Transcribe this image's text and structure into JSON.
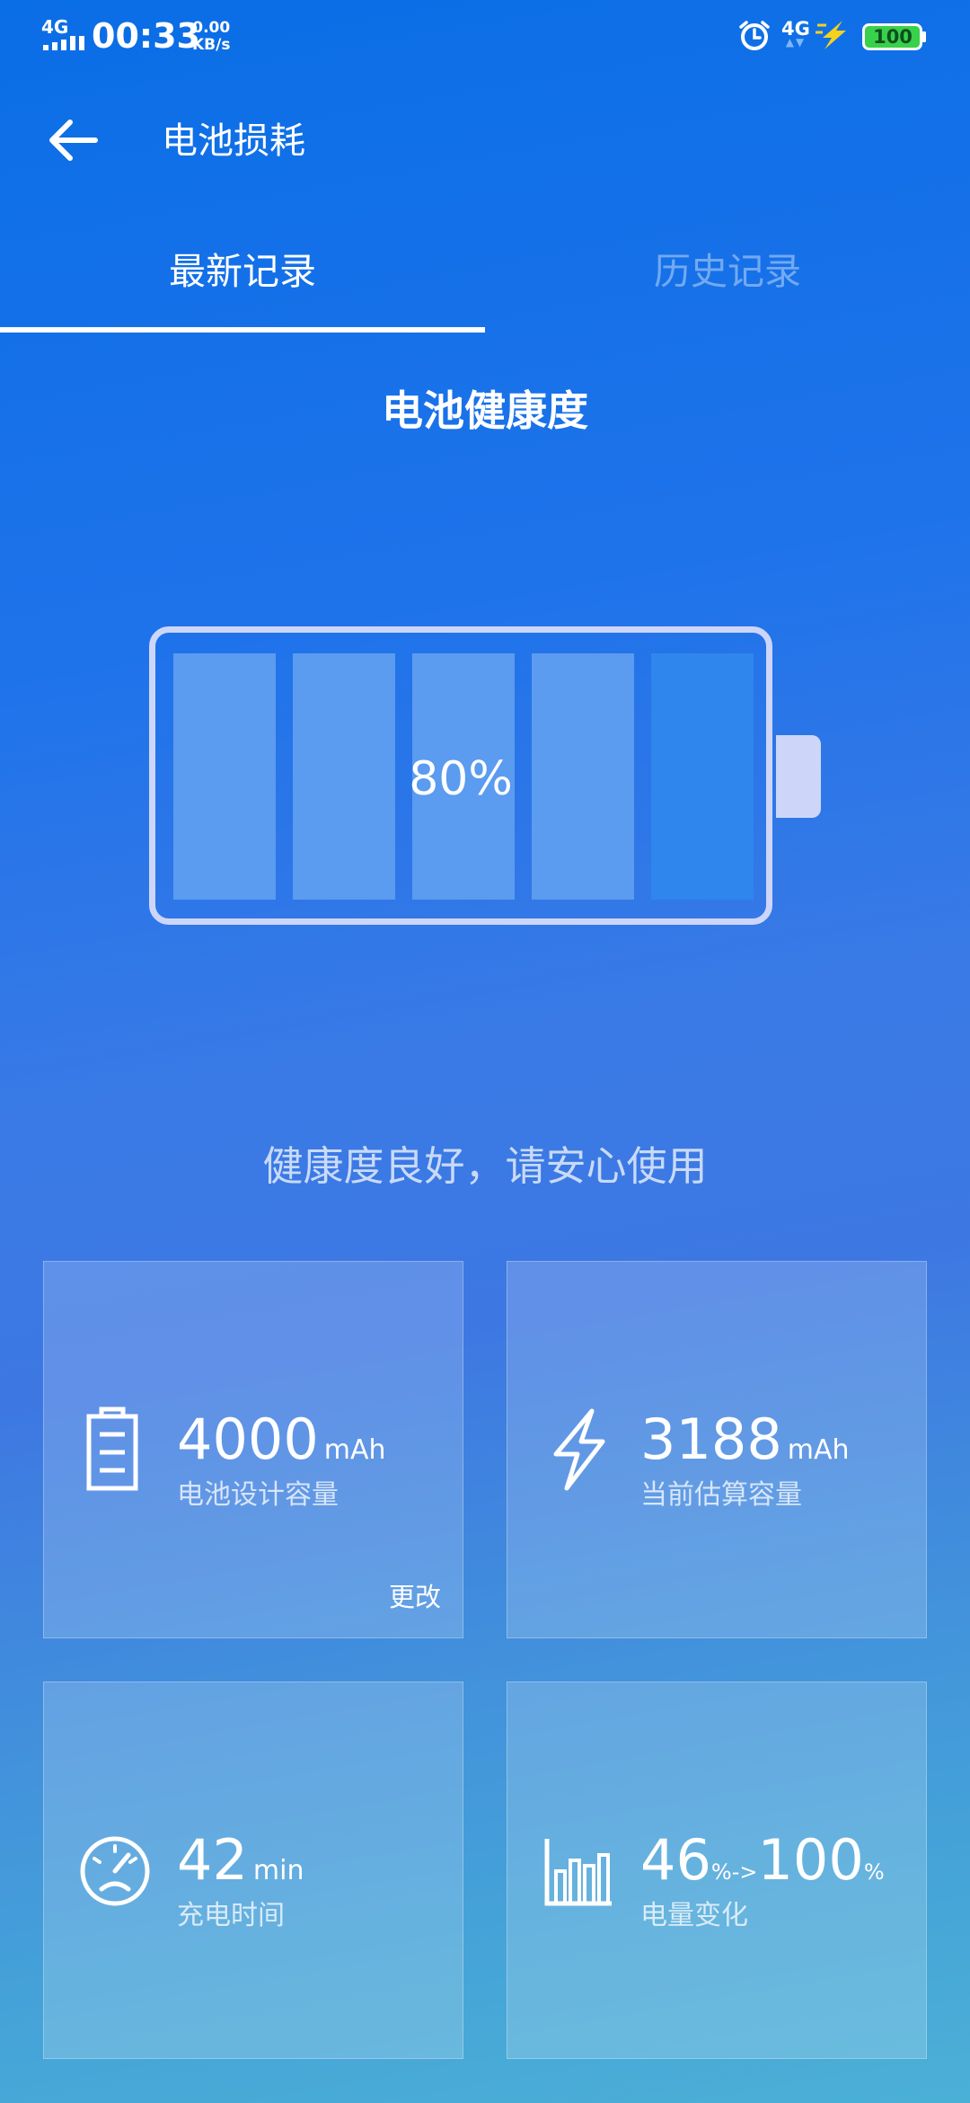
{
  "status_bar": {
    "network_left": "4G",
    "time": "00:33",
    "speed_value": "0.00",
    "speed_unit": "KB/s",
    "network_right": "4G",
    "battery_level": "100",
    "battery_color": "#39d14b"
  },
  "header": {
    "title": "电池损耗"
  },
  "tabs": [
    {
      "label": "最新记录",
      "active": true
    },
    {
      "label": "历史记录",
      "active": false
    }
  ],
  "battery_health": {
    "section_title": "电池健康度",
    "percent_text": "80%",
    "percent": 80,
    "status_message": "健康度良好，请安心使用"
  },
  "cards": [
    {
      "icon": "battery-icon",
      "value": "4000",
      "unit": "mAh",
      "label": "电池设计容量",
      "action": "更改"
    },
    {
      "icon": "lightning-icon",
      "value": "3188",
      "unit": "mAh",
      "label": "当前估算容量"
    },
    {
      "icon": "speedometer-icon",
      "value": "42",
      "unit": "min",
      "label": "充电时间"
    },
    {
      "icon": "bar-chart-icon",
      "value_from": "46",
      "unit_from": "%->",
      "value_to": "100",
      "unit_to": "%",
      "label": "电量变化"
    }
  ]
}
